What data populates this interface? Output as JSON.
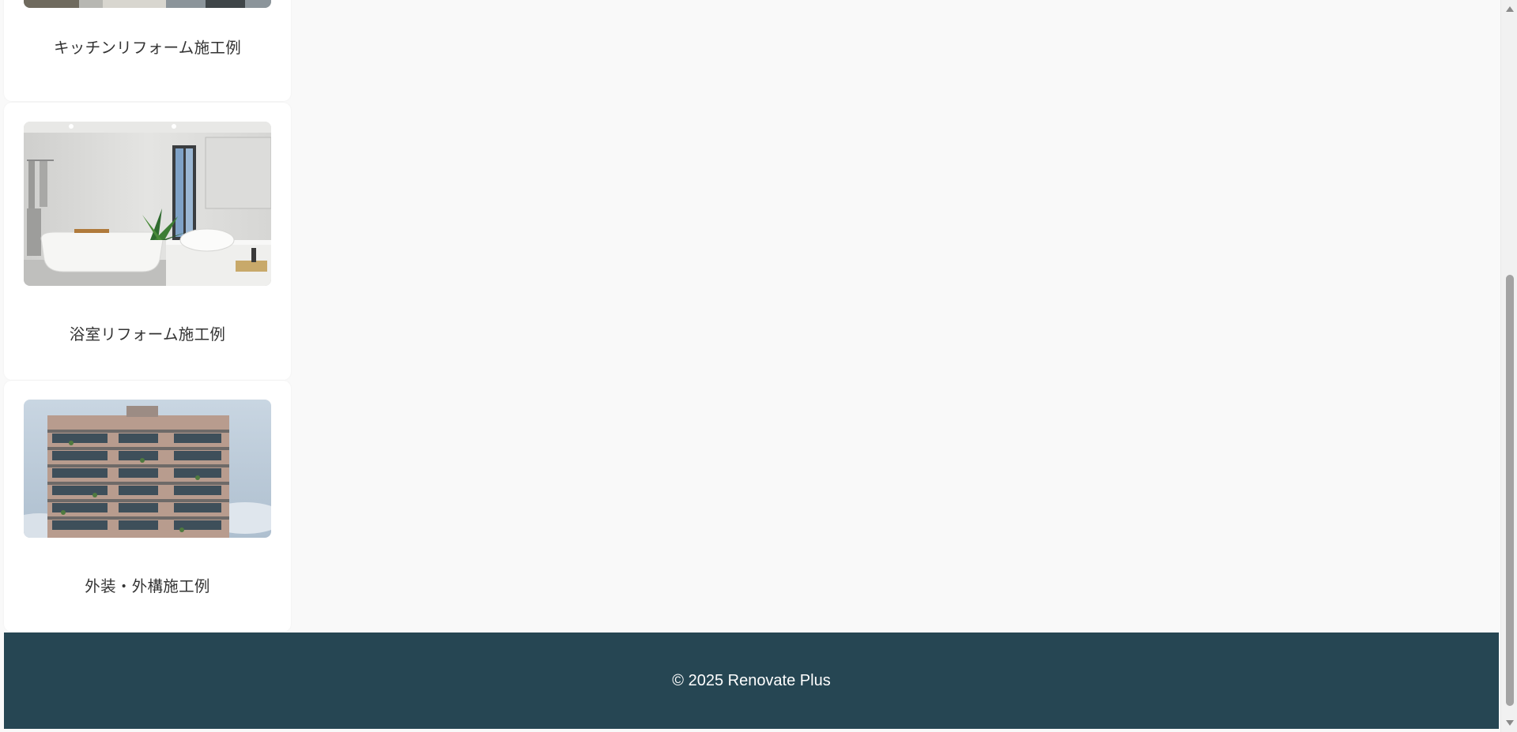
{
  "cards": [
    {
      "caption": "キッチンリフォーム施工例",
      "image": "kitchen-photo"
    },
    {
      "caption": "浴室リフォーム施工例",
      "image": "bathroom-photo"
    },
    {
      "caption": "外装・外構施工例",
      "image": "exterior-building-photo"
    }
  ],
  "footer": {
    "copyright": "© 2025 Renovate Plus"
  },
  "colors": {
    "footer_bg": "#264653",
    "page_bg": "#f9f9f9",
    "card_bg": "#ffffff"
  }
}
